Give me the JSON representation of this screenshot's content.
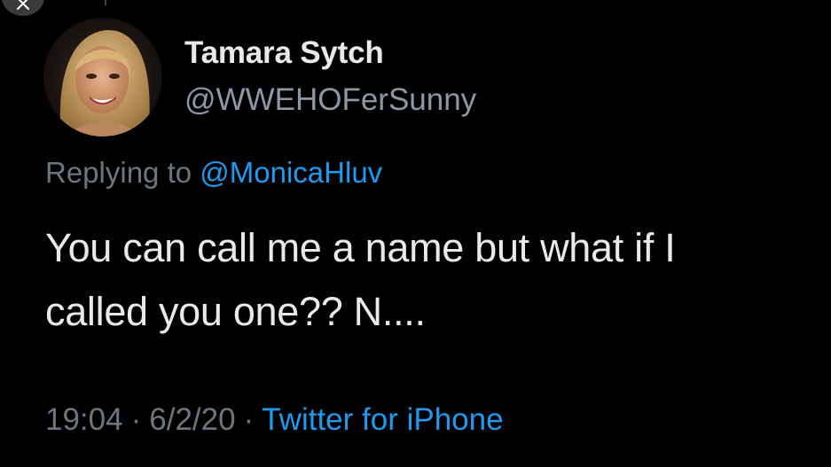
{
  "colors": {
    "background": "#000000",
    "text_primary": "#E7E9EA",
    "text_secondary": "#6E767D",
    "link": "#1D9BF0"
  },
  "header": {
    "close_icon": "close-icon"
  },
  "tweet": {
    "author": {
      "display_name": "Tamara Sytch",
      "handle": "@WWEHOFerSunny"
    },
    "replying_prefix": "Replying to",
    "replying_to": "@MonicaHluv",
    "text": "You can call me a name but what if I\ncalled you one?? N....",
    "time": "19:04",
    "separator": "·",
    "date": "6/2/20",
    "source": "Twitter for iPhone"
  }
}
